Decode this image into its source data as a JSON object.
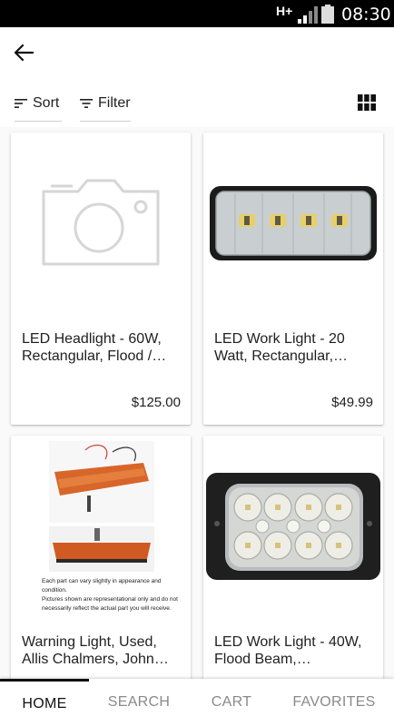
{
  "status_bar": {
    "network": "H+",
    "time": "08:30",
    "icons": [
      "signal-icon",
      "battery-icon"
    ]
  },
  "header": {
    "back_icon": "arrow-left-icon"
  },
  "toolbar": {
    "sort_label": "Sort",
    "filter_label": "Filter",
    "view_icon": "grid-view-icon"
  },
  "products": [
    {
      "name": "LED Headlight - 60W, Rectangular, Flood /…",
      "price": "$125.00",
      "image": "camera-placeholder"
    },
    {
      "name": "LED Work Light - 20 Watt, Rectangular,…",
      "price": "$49.99",
      "image": "rectangular-led-work-light"
    },
    {
      "name": "Warning Light, Used, Allis Chalmers, John…",
      "price": "",
      "image": "amber-warning-light-photo",
      "image_caption": [
        "Each part can vary slightly in appearance and condition.",
        "Pictures shown are representational only and do not",
        "necessarily reflect the actual part you will receive."
      ]
    },
    {
      "name": "LED Work Light - 40W, Flood Beam,…",
      "price": "",
      "image": "rectangular-led-flood-light"
    }
  ],
  "bottom_nav": {
    "items": [
      "HOME",
      "SEARCH",
      "CART",
      "FAVORITES"
    ],
    "active": "HOME"
  }
}
